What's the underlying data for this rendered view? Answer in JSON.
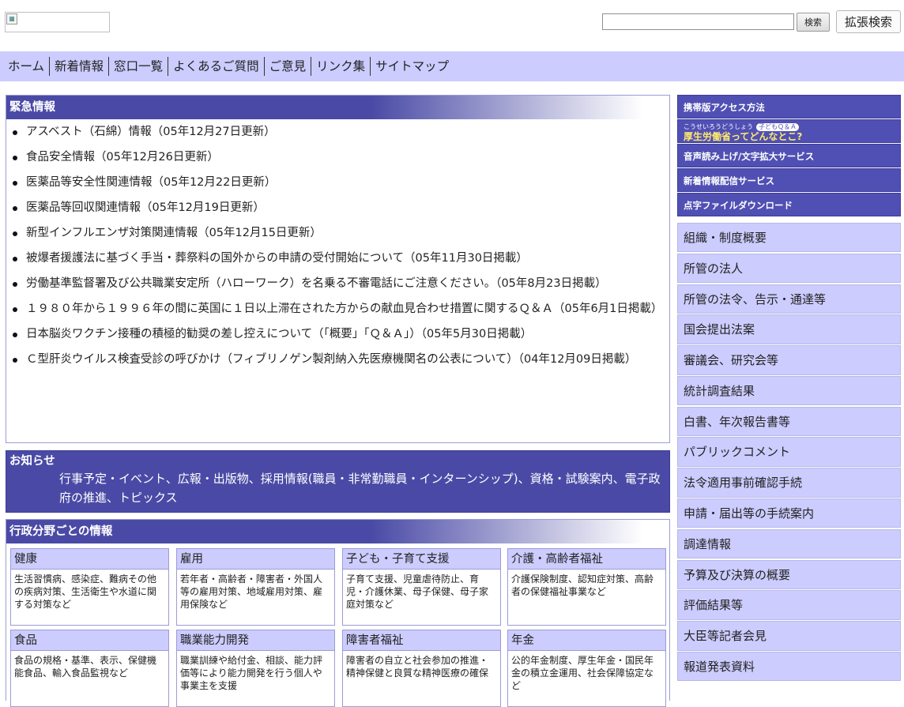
{
  "header": {
    "search_placeholder": "",
    "search_button": "検索",
    "advanced_search_button": "拡張検索"
  },
  "globalnav": [
    "ホーム",
    "新着情報",
    "窓口一覧",
    "よくあるご質問",
    "ご意見",
    "リンク集",
    "サイトマップ"
  ],
  "urgent": {
    "title": "緊急情報",
    "items": [
      "アスベスト（石綿）情報（05年12月27日更新）",
      "食品安全情報（05年12月26日更新）",
      "医薬品等安全性関連情報（05年12月22日更新）",
      "医薬品等回収関連情報（05年12月19日更新）",
      "新型インフルエンザ対策関連情報（05年12月15日更新）",
      "被爆者援護法に基づく手当・葬祭料の国外からの申請の受付開始について（05年11月30日掲載）",
      "労働基準監督署及び公共職業安定所（ハローワーク）を名乗る不審電話にご注意ください。（05年8月23日掲載）",
      "１９８０年から１９９６年の間に英国に１日以上滞在された方からの献血見合わせ措置に関するＱ＆Ａ（05年6月1日掲載）",
      "日本脳炎ワクチン接種の積極的勧奨の差し控えについて（「概要」「Ｑ＆Ａ」）（05年5月30日掲載）",
      "Ｃ型肝炎ウイルス検査受診の呼びかけ（フィブリノゲン製剤納入先医療機関名の公表について）（04年12月09日掲載）"
    ]
  },
  "notice": {
    "title": "お知らせ",
    "body": "行事予定・イベント、広報・出版物、採用情報(職員・非常勤職員・インターンシップ)、資格・試験案内、電子政府の推進、トピックス"
  },
  "fields": {
    "title": "行政分野ごとの情報",
    "items": [
      {
        "title": "健康",
        "desc": "生活習慣病、感染症、難病その他の疾病対策、生活衛生や水道に関する対策など"
      },
      {
        "title": "雇用",
        "desc": "若年者・高齢者・障害者・外国人等の雇用対策、地域雇用対策、雇用保険など"
      },
      {
        "title": "子ども・子育て支援",
        "desc": "子育て支援、児童虐待防止、育児・介護休業、母子保健、母子家庭対策など"
      },
      {
        "title": "介護・高齢者福祉",
        "desc": "介護保険制度、認知症対策、高齢者の保健福祉事業など"
      },
      {
        "title": "食品",
        "desc": "食品の規格・基準、表示、保健機能食品、輸入食品監視など"
      },
      {
        "title": "職業能力開発",
        "desc": "職業訓練や給付金、相談、能力評価等により能力開発を行う個人や事業主を支援"
      },
      {
        "title": "障害者福祉",
        "desc": "障害者の自立と社会参加の推進・精神保健と良質な精神医療の確保"
      },
      {
        "title": "年金",
        "desc": "公的年金制度、厚生年金・国民年金の積立金運用、社会保障協定など"
      }
    ]
  },
  "side": {
    "services": [
      "携帯版アクセス方法",
      "音声読み上げ/文字拡大サービス",
      "新着情報配信サービス",
      "点字ファイルダウンロード"
    ],
    "qa": {
      "ruby": "こうせいろうどうしょう",
      "badge": "子どもＱ＆Ａ",
      "main": "厚生労働省ってどんなとこ?"
    },
    "menu": [
      "組織・制度概要",
      "所管の法人",
      "所管の法令、告示・通達等",
      "国会提出法案",
      "審議会、研究会等",
      "統計調査結果",
      "白書、年次報告書等",
      "パブリックコメント",
      "法令適用事前確認手続",
      "申請・届出等の手続案内",
      "調達情報",
      "予算及び決算の概要",
      "評価結果等",
      "大臣等記者会見",
      "報道発表資料"
    ]
  }
}
